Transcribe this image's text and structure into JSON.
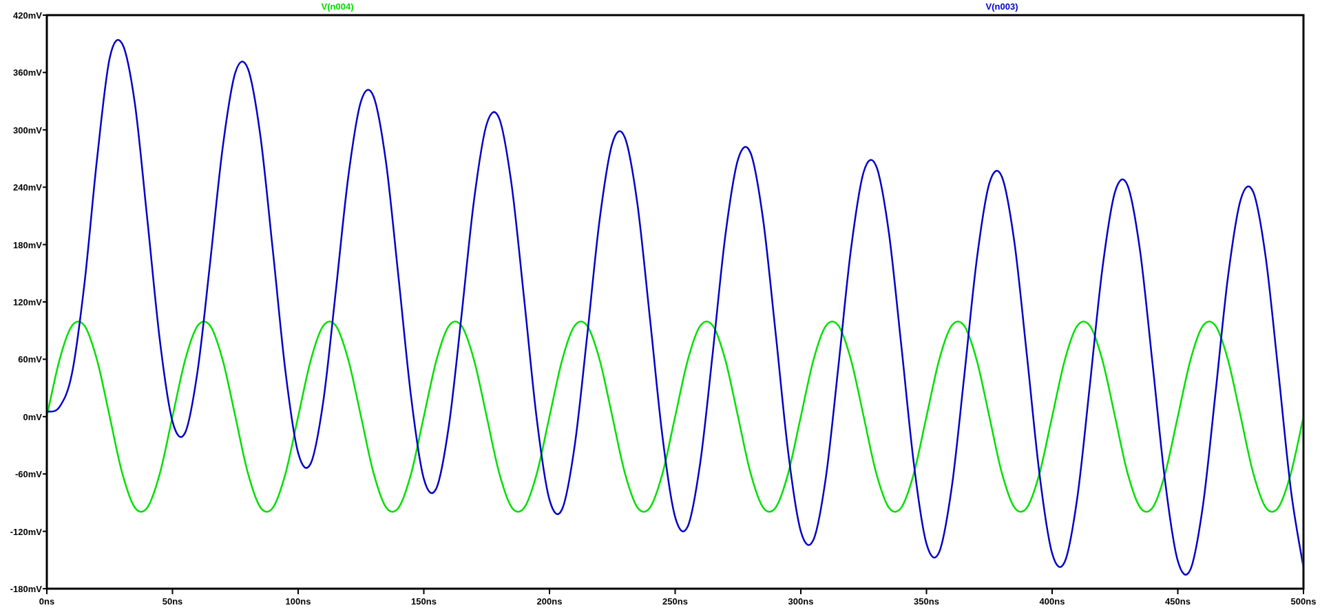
{
  "plot": {
    "chart_data": {
      "type": "line",
      "x": [
        0,
        5,
        10,
        15,
        20,
        25,
        30,
        35,
        40,
        45,
        50,
        55,
        60,
        65,
        70,
        75,
        80,
        85,
        90,
        95,
        100,
        105,
        110,
        115,
        120,
        125,
        130,
        135,
        140,
        145,
        150,
        155,
        160,
        165,
        170,
        175,
        180,
        185,
        190,
        195,
        200,
        205,
        210,
        215,
        220,
        225,
        230,
        235,
        240,
        245,
        250,
        255,
        260,
        265,
        270,
        275,
        280,
        285,
        290,
        295,
        300,
        305,
        310,
        315,
        320,
        325,
        330,
        335,
        340,
        345,
        350,
        355,
        360,
        365,
        370,
        375,
        380,
        385,
        390,
        395,
        400,
        405,
        410,
        415,
        420,
        425,
        430,
        435,
        440,
        445,
        450,
        455,
        460,
        465,
        470,
        475,
        480,
        485,
        490,
        495,
        500
      ],
      "series": [
        {
          "name": "V(n004)",
          "color": "#00e000",
          "values": [
            0,
            59,
            95,
            95,
            59,
            0,
            -59,
            -95,
            -95,
            -59,
            0,
            59,
            95,
            95,
            59,
            0,
            -59,
            -95,
            -95,
            -59,
            0,
            59,
            95,
            95,
            59,
            0,
            -59,
            -95,
            -95,
            -59,
            0,
            59,
            95,
            95,
            59,
            0,
            -59,
            -95,
            -95,
            -59,
            0,
            59,
            95,
            95,
            59,
            0,
            -59,
            -95,
            -95,
            -59,
            0,
            59,
            95,
            95,
            59,
            0,
            -59,
            -95,
            -95,
            -59,
            0,
            59,
            95,
            95,
            59,
            0,
            -59,
            -95,
            -95,
            -59,
            0,
            59,
            95,
            95,
            59,
            0,
            -59,
            -95,
            -95,
            -59,
            0,
            59,
            95,
            95,
            59,
            0,
            -59,
            -95,
            -95,
            -59,
            0,
            59,
            95,
            95,
            59,
            0,
            -59,
            -95,
            -95,
            -59,
            0
          ]
        },
        {
          "name": "V(n003)",
          "color": "#0000c8",
          "values": [
            5,
            10,
            45,
            140,
            270,
            375,
            390,
            328,
            206,
            79,
            -5,
            -17,
            48,
            162,
            282,
            360,
            364,
            293,
            172,
            46,
            -38,
            -49,
            16,
            132,
            252,
            330,
            335,
            265,
            144,
            19,
            -65,
            -75,
            -9,
            106,
            227,
            306,
            312,
            241,
            121,
            -4,
            -87,
            -97,
            -31,
            85,
            207,
            286,
            292,
            222,
            102,
            -22,
            -105,
            -115,
            -48,
            68,
            190,
            269,
            276,
            206,
            87,
            -38,
            -120,
            -129,
            -63,
            54,
            176,
            256,
            262,
            193,
            74,
            -50,
            -133,
            -142,
            -75,
            42,
            164,
            244,
            251,
            182,
            63,
            -61,
            -143,
            -152,
            -85,
            33,
            155,
            235,
            242,
            173,
            54,
            -69,
            -151,
            -160,
            -93,
            25,
            147,
            227,
            235,
            166,
            47,
            -77,
            -158
          ]
        }
      ],
      "xlim": [
        0,
        500
      ],
      "ylim": [
        -180,
        420
      ],
      "xticks": [
        {
          "value": 0,
          "label": "0ns"
        },
        {
          "value": 50,
          "label": "50ns"
        },
        {
          "value": 100,
          "label": "100ns"
        },
        {
          "value": 150,
          "label": "150ns"
        },
        {
          "value": 200,
          "label": "200ns"
        },
        {
          "value": 250,
          "label": "250ns"
        },
        {
          "value": 300,
          "label": "300ns"
        },
        {
          "value": 350,
          "label": "350ns"
        },
        {
          "value": 400,
          "label": "400ns"
        },
        {
          "value": 450,
          "label": "450ns"
        },
        {
          "value": 500,
          "label": "500ns"
        }
      ],
      "yticks": [
        {
          "value": -180,
          "label": "-180mV"
        },
        {
          "value": -120,
          "label": "-120mV"
        },
        {
          "value": -60,
          "label": "-60mV"
        },
        {
          "value": 0,
          "label": "0mV"
        },
        {
          "value": 60,
          "label": "60mV"
        },
        {
          "value": 120,
          "label": "120mV"
        },
        {
          "value": 180,
          "label": "180mV"
        },
        {
          "value": 240,
          "label": "240mV"
        },
        {
          "value": 300,
          "label": "300mV"
        },
        {
          "value": 360,
          "label": "360mV"
        },
        {
          "value": 420,
          "label": "420mV"
        }
      ]
    }
  }
}
